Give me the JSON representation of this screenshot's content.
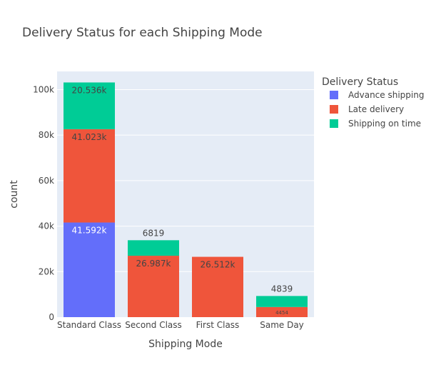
{
  "chart_data": {
    "type": "bar",
    "stacked": true,
    "title": "Delivery Status for each Shipping Mode",
    "xlabel": "Shipping Mode",
    "ylabel": "count",
    "categories": [
      "Standard Class",
      "Second Class",
      "First Class",
      "Same Day"
    ],
    "ylim": [
      0,
      108000
    ],
    "yticks": [
      0,
      20000,
      40000,
      60000,
      80000,
      100000
    ],
    "ytick_labels": [
      "0",
      "20k",
      "40k",
      "60k",
      "80k",
      "100k"
    ],
    "grid": true,
    "legend_title": "Delivery Status",
    "legend_position": "top-right",
    "series": [
      {
        "name": "Advance shipping",
        "color": "#636efa",
        "values": [
          41592,
          0,
          0,
          0
        ],
        "labels": [
          "41.592k",
          "",
          "",
          ""
        ]
      },
      {
        "name": "Late delivery",
        "color": "#ef553b",
        "values": [
          41023,
          26987,
          26512,
          4454
        ],
        "labels": [
          "41.023k",
          "26.987k",
          "26.512k",
          "4454"
        ]
      },
      {
        "name": "Shipping on time",
        "color": "#00cc96",
        "values": [
          20536,
          6819,
          0,
          4839
        ],
        "labels": [
          "20.536k",
          "6819",
          "",
          "4839"
        ]
      }
    ]
  }
}
